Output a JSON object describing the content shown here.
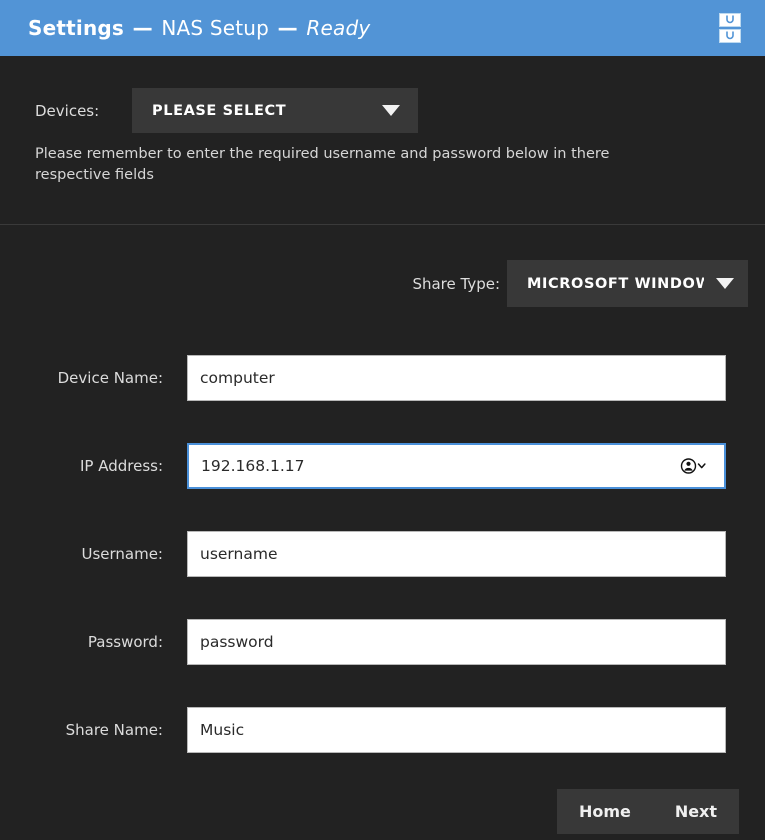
{
  "titlebar": {
    "app_name": "Settings",
    "separator": "—",
    "page_name": "NAS Setup",
    "status": "Ready",
    "icon": "file-cabinet-icon",
    "background_color": "#5294d6",
    "text_color": "#ffffff"
  },
  "devices": {
    "label": "Devices:",
    "select_value": "PLEASE SELECT",
    "note": "Please remember to enter the required username and password below in there respective fields"
  },
  "share_type": {
    "label": "Share Type:",
    "select_value": "MICROSOFT WINDOW..."
  },
  "fields": [
    {
      "name": "device-name",
      "label": "Device Name:",
      "value": "computer",
      "focused": false,
      "has_autofill_icon": false
    },
    {
      "name": "ip-address",
      "label": "IP Address:",
      "value": "192.168.1.17",
      "focused": true,
      "has_autofill_icon": true
    },
    {
      "name": "username",
      "label": "Username:",
      "value": "username",
      "focused": false,
      "has_autofill_icon": false
    },
    {
      "name": "password",
      "label": "Password:",
      "value": "password",
      "focused": false,
      "has_autofill_icon": false
    },
    {
      "name": "share-name",
      "label": "Share Name:",
      "value": "Music",
      "focused": false,
      "has_autofill_icon": false
    }
  ],
  "footer": {
    "home_label": "Home",
    "next_label": "Next"
  },
  "colors": {
    "page_background": "#222222",
    "accent_blue": "#5294d6",
    "focus_border": "#4a90d9",
    "control_gray": "#383838",
    "input_white": "#ffffff"
  }
}
